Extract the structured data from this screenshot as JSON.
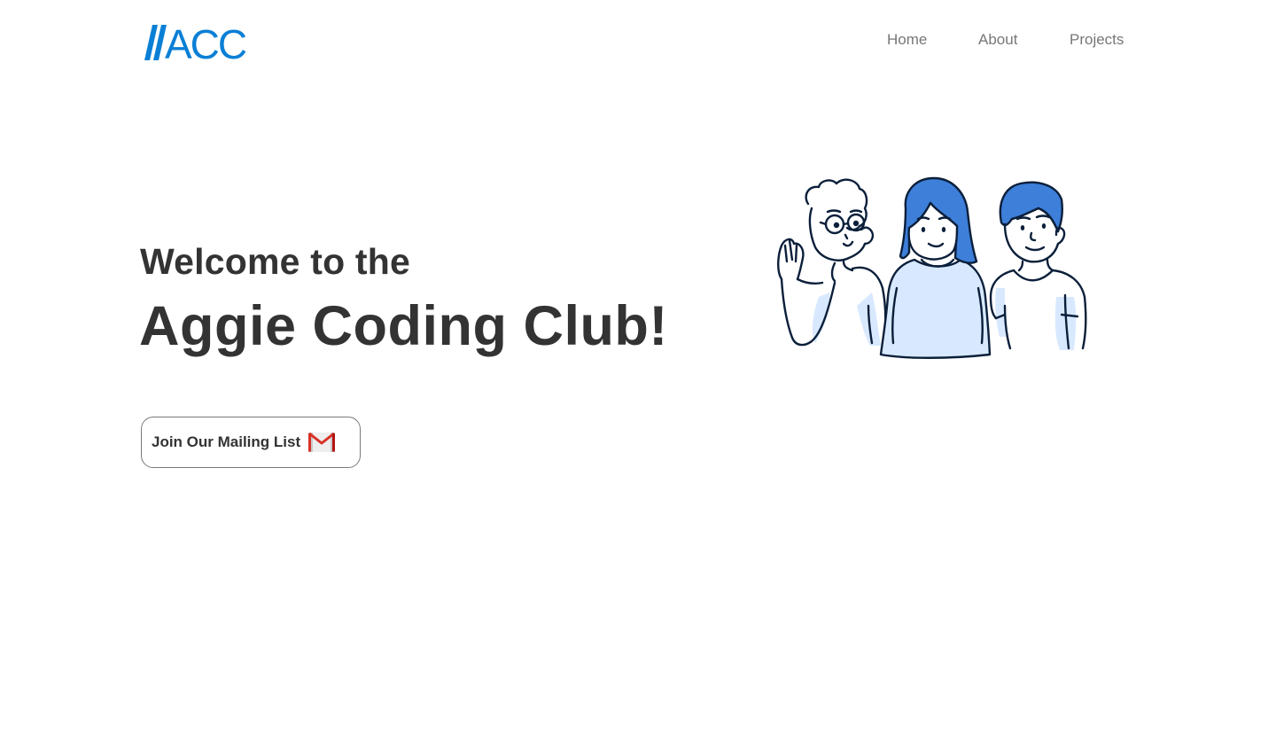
{
  "header": {
    "logo_text": "//ACC",
    "logo_color": "#0a7fd6",
    "nav": [
      {
        "label": "Home"
      },
      {
        "label": "About"
      },
      {
        "label": "Projects"
      }
    ]
  },
  "hero": {
    "subtitle": "Welcome to the",
    "title": "Aggie Coding Club!",
    "mailing_button": {
      "label": "Join Our Mailing List",
      "icon": "gmail-icon"
    },
    "illustration": "three-students-illustration"
  },
  "colors": {
    "text": "#333333",
    "nav_text": "#777777",
    "accent_blue": "#3d7fd9",
    "light_blue": "#d8e9ff",
    "outline": "#0b1f3a"
  }
}
